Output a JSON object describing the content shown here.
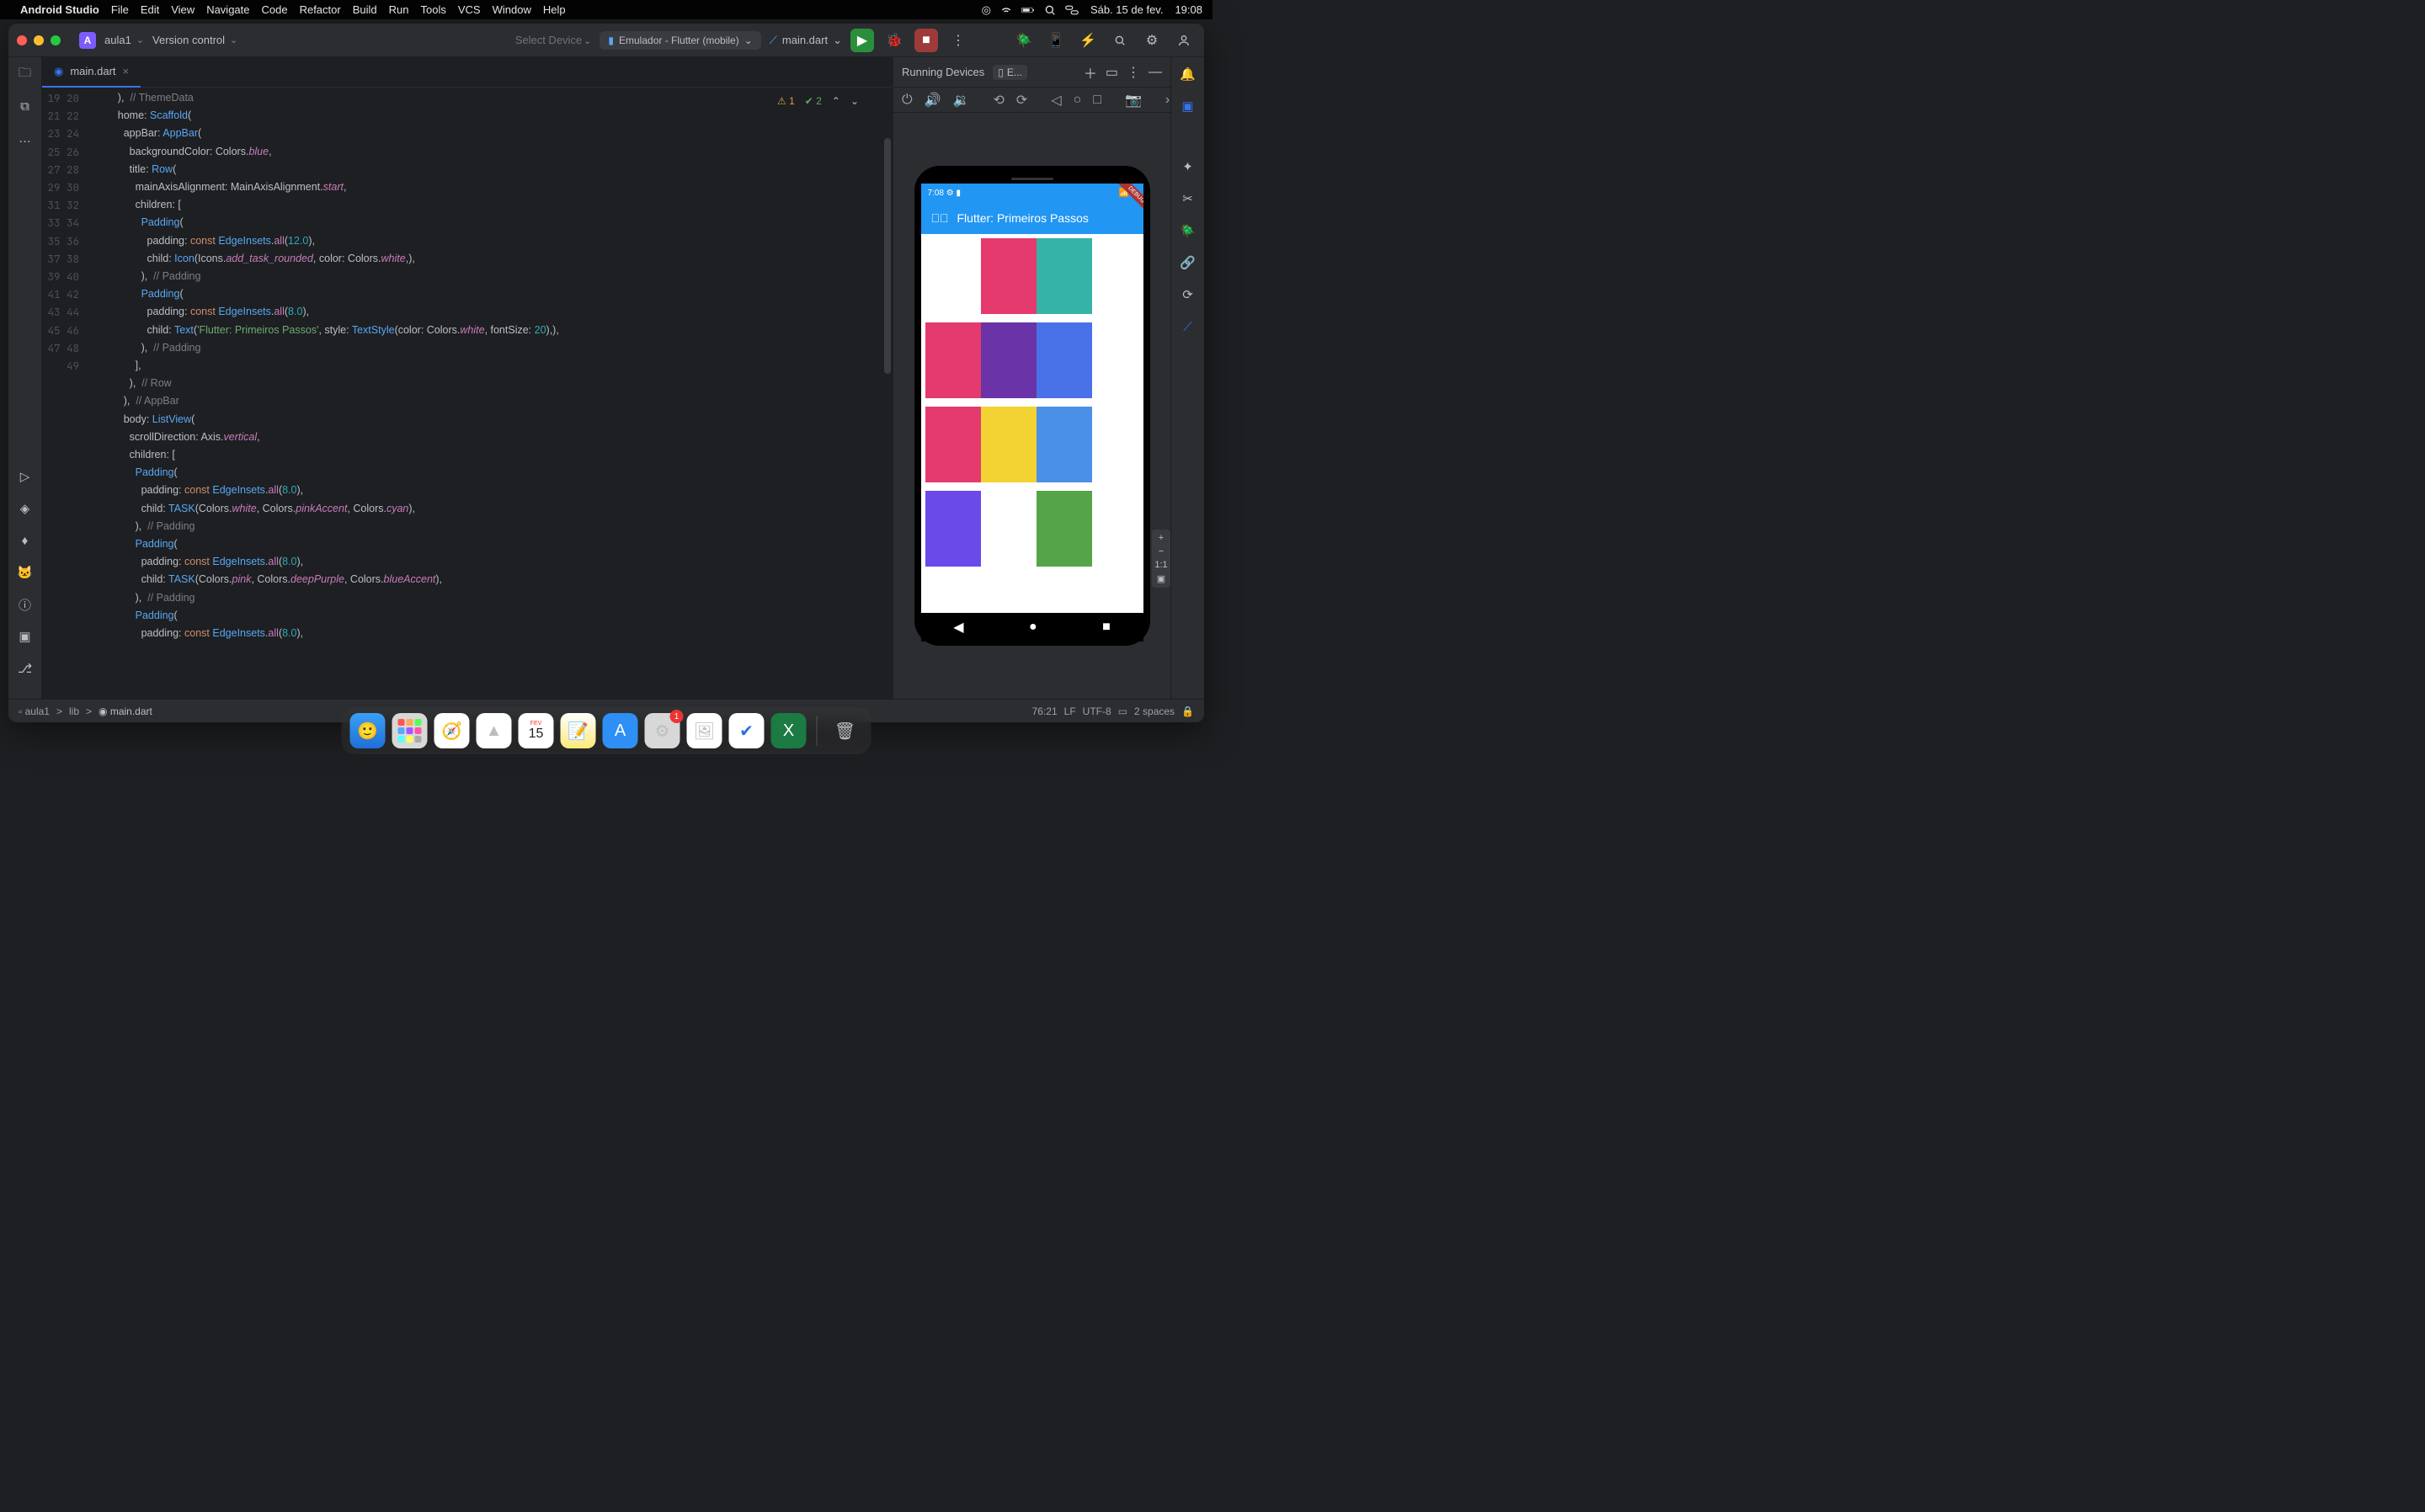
{
  "menubar": {
    "app": "Android Studio",
    "items": [
      "File",
      "Edit",
      "View",
      "Navigate",
      "Code",
      "Refactor",
      "Build",
      "Run",
      "Tools",
      "VCS",
      "Window",
      "Help"
    ],
    "date": "Sáb. 15 de fev.",
    "time": "19:08"
  },
  "toolbar": {
    "project_badge": "A",
    "project": "aula1",
    "vcs": "Version control",
    "select_device": "Select Device",
    "device": "Emulador - Flutter (mobile)",
    "config": "main.dart"
  },
  "tab": {
    "name": "main.dart"
  },
  "editor": {
    "warn_count": "1",
    "ok_count": "2",
    "lines": [
      {
        "n": "19",
        "html": "        ),  <span class='com'>// ThemeData</span>"
      },
      {
        "n": "20",
        "html": "        home: <span class='cls'>Scaffold</span>("
      },
      {
        "n": "21",
        "html": "          appBar: <span class='cls'>AppBar</span>("
      },
      {
        "n": "22",
        "html": "            backgroundColor: <span class='type'>Colors</span>.<span class='prop'>blue</span>,"
      },
      {
        "n": "23",
        "html": "            title: <span class='cls'>Row</span>("
      },
      {
        "n": "24",
        "html": "              mainAxisAlignment: <span class='type'>MainAxisAlignment</span>.<span class='prop'>start</span>,"
      },
      {
        "n": "25",
        "html": "              children: ["
      },
      {
        "n": "26",
        "html": "                <span class='cls'>Padding</span>("
      },
      {
        "n": "27",
        "html": "                  padding: <span class='kw'>const</span> <span class='cls'>EdgeInsets</span>.<span class='fn'>all</span>(<span class='num'>12.0</span>),"
      },
      {
        "n": "28",
        "html": "                  child: <span class='cls'>Icon</span>(<span class='type'>Icons</span>.<span class='prop'>add_task_rounded</span>, color: <span class='type'>Colors</span>.<span class='prop'>white</span>,),"
      },
      {
        "n": "29",
        "html": "                ),  <span class='com'>// Padding</span>"
      },
      {
        "n": "30",
        "html": "                <span class='cls'>Padding</span>("
      },
      {
        "n": "31",
        "html": "                  padding: <span class='kw'>const</span> <span class='cls'>EdgeInsets</span>.<span class='fn'>all</span>(<span class='num'>8.0</span>),"
      },
      {
        "n": "32",
        "html": "                  child: <span class='cls'>Text</span>(<span class='str'>'Flutter: Primeiros Passos'</span>, style: <span class='cls'>TextStyle</span>(color: <span class='type'>Colors</span>.<span class='prop'>white</span>, fontSize: <span class='num'>20</span>),),"
      },
      {
        "n": "33",
        "html": "                ),  <span class='com'>// Padding</span>"
      },
      {
        "n": "34",
        "html": "              ],"
      },
      {
        "n": "35",
        "html": "            ),  <span class='com'>// Row</span>"
      },
      {
        "n": "36",
        "html": "          ),  <span class='com'>// AppBar</span>"
      },
      {
        "n": "37",
        "html": "          body: <span class='cls'>ListView</span>("
      },
      {
        "n": "38",
        "html": "            scrollDirection: <span class='type'>Axis</span>.<span class='prop'>vertical</span>,"
      },
      {
        "n": "39",
        "html": "            children: ["
      },
      {
        "n": "40",
        "html": "              <span class='cls'>Padding</span>("
      },
      {
        "n": "41",
        "html": "                padding: <span class='kw'>const</span> <span class='cls'>EdgeInsets</span>.<span class='fn'>all</span>(<span class='num'>8.0</span>),"
      },
      {
        "n": "42",
        "html": "                child: <span class='cls'>TASK</span>(<span class='type'>Colors</span>.<span class='prop'>white</span>, <span class='type'>Colors</span>.<span class='prop'>pinkAccent</span>, <span class='type'>Colors</span>.<span class='prop'>cyan</span>),"
      },
      {
        "n": "43",
        "html": "              ),  <span class='com'>// Padding</span>"
      },
      {
        "n": "44",
        "html": "              <span class='cls'>Padding</span>("
      },
      {
        "n": "45",
        "html": "                padding: <span class='kw'>const</span> <span class='cls'>EdgeInsets</span>.<span class='fn'>all</span>(<span class='num'>8.0</span>),"
      },
      {
        "n": "46",
        "html": "                child: <span class='cls'>TASK</span>(<span class='type'>Colors</span>.<span class='prop'>pink</span>, <span class='type'>Colors</span>.<span class='prop'>deepPurple</span>, <span class='type'>Colors</span>.<span class='prop'>blueAccent</span>),"
      },
      {
        "n": "47",
        "html": "              ),  <span class='com'>// Padding</span>"
      },
      {
        "n": "48",
        "html": "              <span class='cls'>Padding</span>("
      },
      {
        "n": "49",
        "html": "                padding: <span class='kw'>const</span> <span class='cls'>EdgeInsets</span>.<span class='fn'>all</span>(<span class='num'>8.0</span>),"
      }
    ]
  },
  "devices": {
    "title": "Running Devices",
    "tab": "E...",
    "zoom_ratio": "1:1"
  },
  "phone": {
    "time": "7:08",
    "app_title": "Flutter: Primeiros Passos",
    "rows": [
      [
        "#ffffff",
        "#e43a6e",
        "#36b3a8"
      ],
      [
        "#e43a6e",
        "#6a33a8",
        "#4a72e8"
      ],
      [
        "#e43a6e",
        "#f2d333",
        "#4a8fe8"
      ],
      [
        "#6a4ae8",
        "#ffffff",
        "#55a548"
      ]
    ]
  },
  "breadcrumb": {
    "parts": [
      "aula1",
      "lib",
      "main.dart"
    ],
    "cursor": "76:21",
    "eol": "LF",
    "enc": "UTF-8",
    "indent": "2 spaces"
  },
  "dock": {
    "apps": [
      "finder",
      "launchpad",
      "safari",
      "androidstudio",
      "calendar",
      "notes",
      "appstore",
      "settings",
      "preview",
      "todo",
      "excel"
    ],
    "calendar_day": "15",
    "settings_badge": "1"
  }
}
